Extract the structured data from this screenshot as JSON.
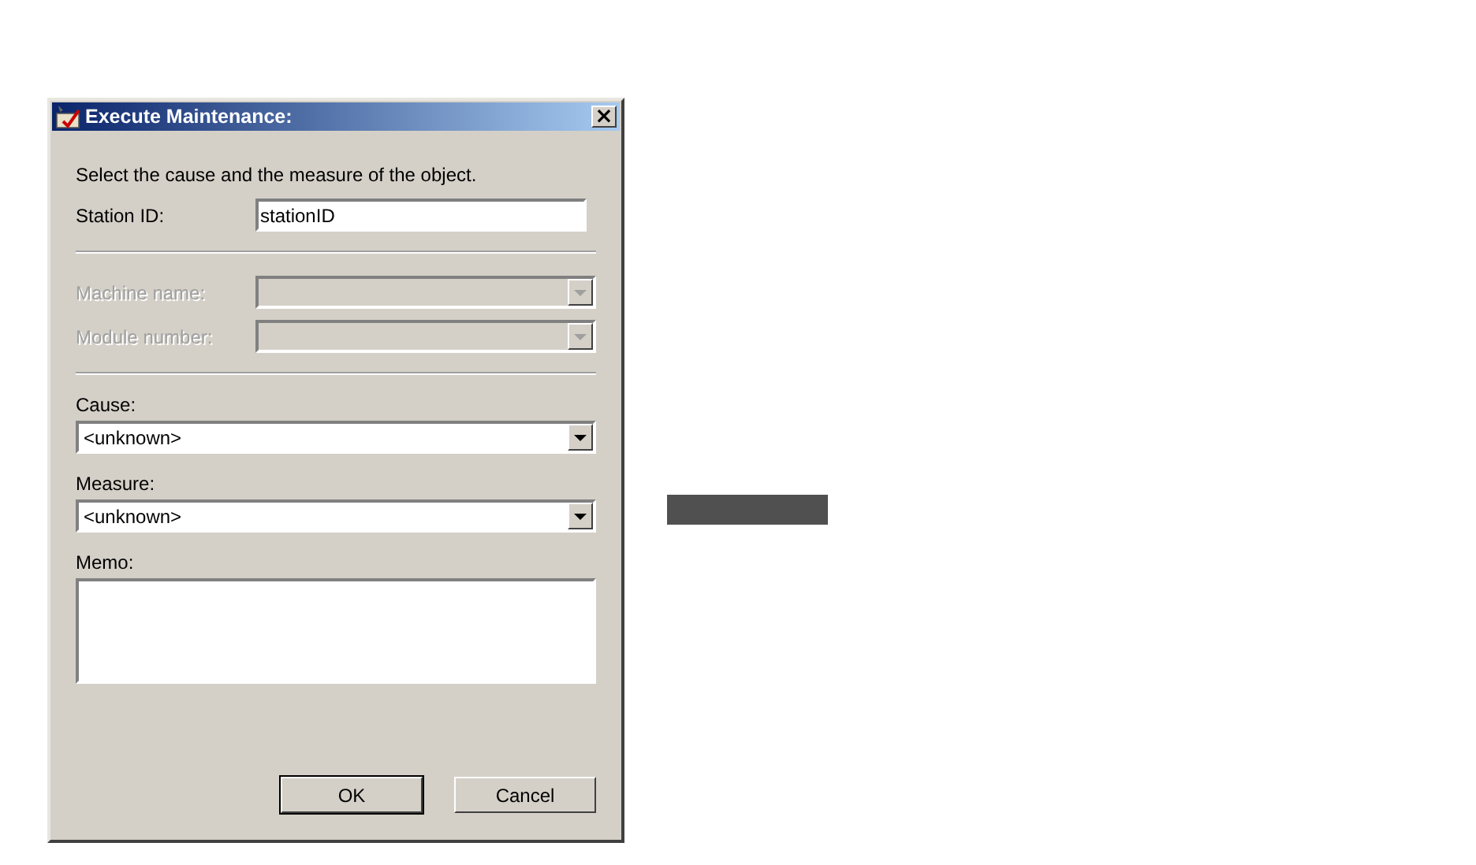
{
  "window": {
    "title": "Execute Maintenance:",
    "close": "×"
  },
  "intro": "Select the cause and the measure of the object.",
  "station_id": {
    "label": "Station ID:",
    "value": "stationID"
  },
  "machine_fields": [
    {
      "label": "Machine name:",
      "disabled": true
    },
    {
      "label": "Module number:",
      "disabled": true
    }
  ],
  "selects": [
    {
      "label": "Cause:",
      "value": "<unknown>"
    },
    {
      "label": "Measure:",
      "value": "<unknown>"
    }
  ],
  "memo": {
    "label": "Memo:"
  },
  "buttons": [
    {
      "label": "OK",
      "default": true
    },
    {
      "label": "Cancel",
      "default": false
    }
  ]
}
